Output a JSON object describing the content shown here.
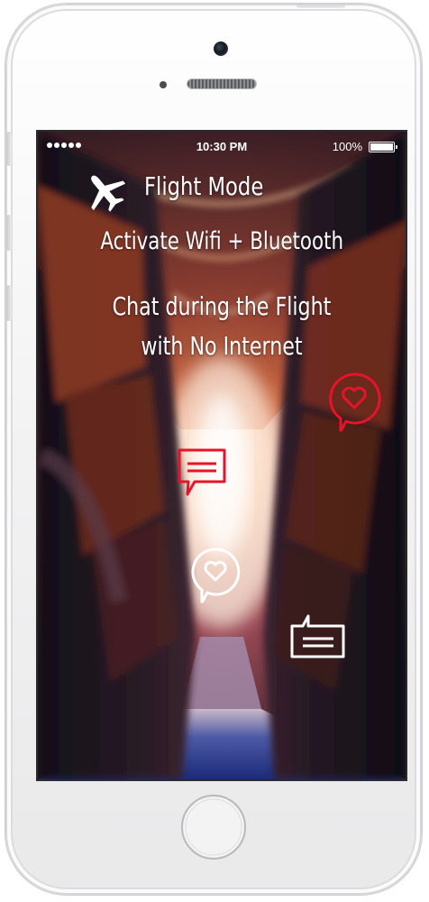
{
  "status_bar": {
    "time": "10:30 PM",
    "battery": "100%"
  },
  "content": {
    "title": "Flight Mode",
    "subtitle": "Activate Wifi + Bluetooth",
    "headline_1": "Chat during the Flight",
    "headline_2": "with No Internet"
  },
  "icons": [
    "airplane-icon",
    "heart-bubble-icon",
    "chat-bubble-icon",
    "heart-bubble-icon",
    "message-bubble-icon"
  ],
  "colors": {
    "accent_red": "#e8122a",
    "text": "#ffffff",
    "device_body": "#f2f2f3"
  }
}
